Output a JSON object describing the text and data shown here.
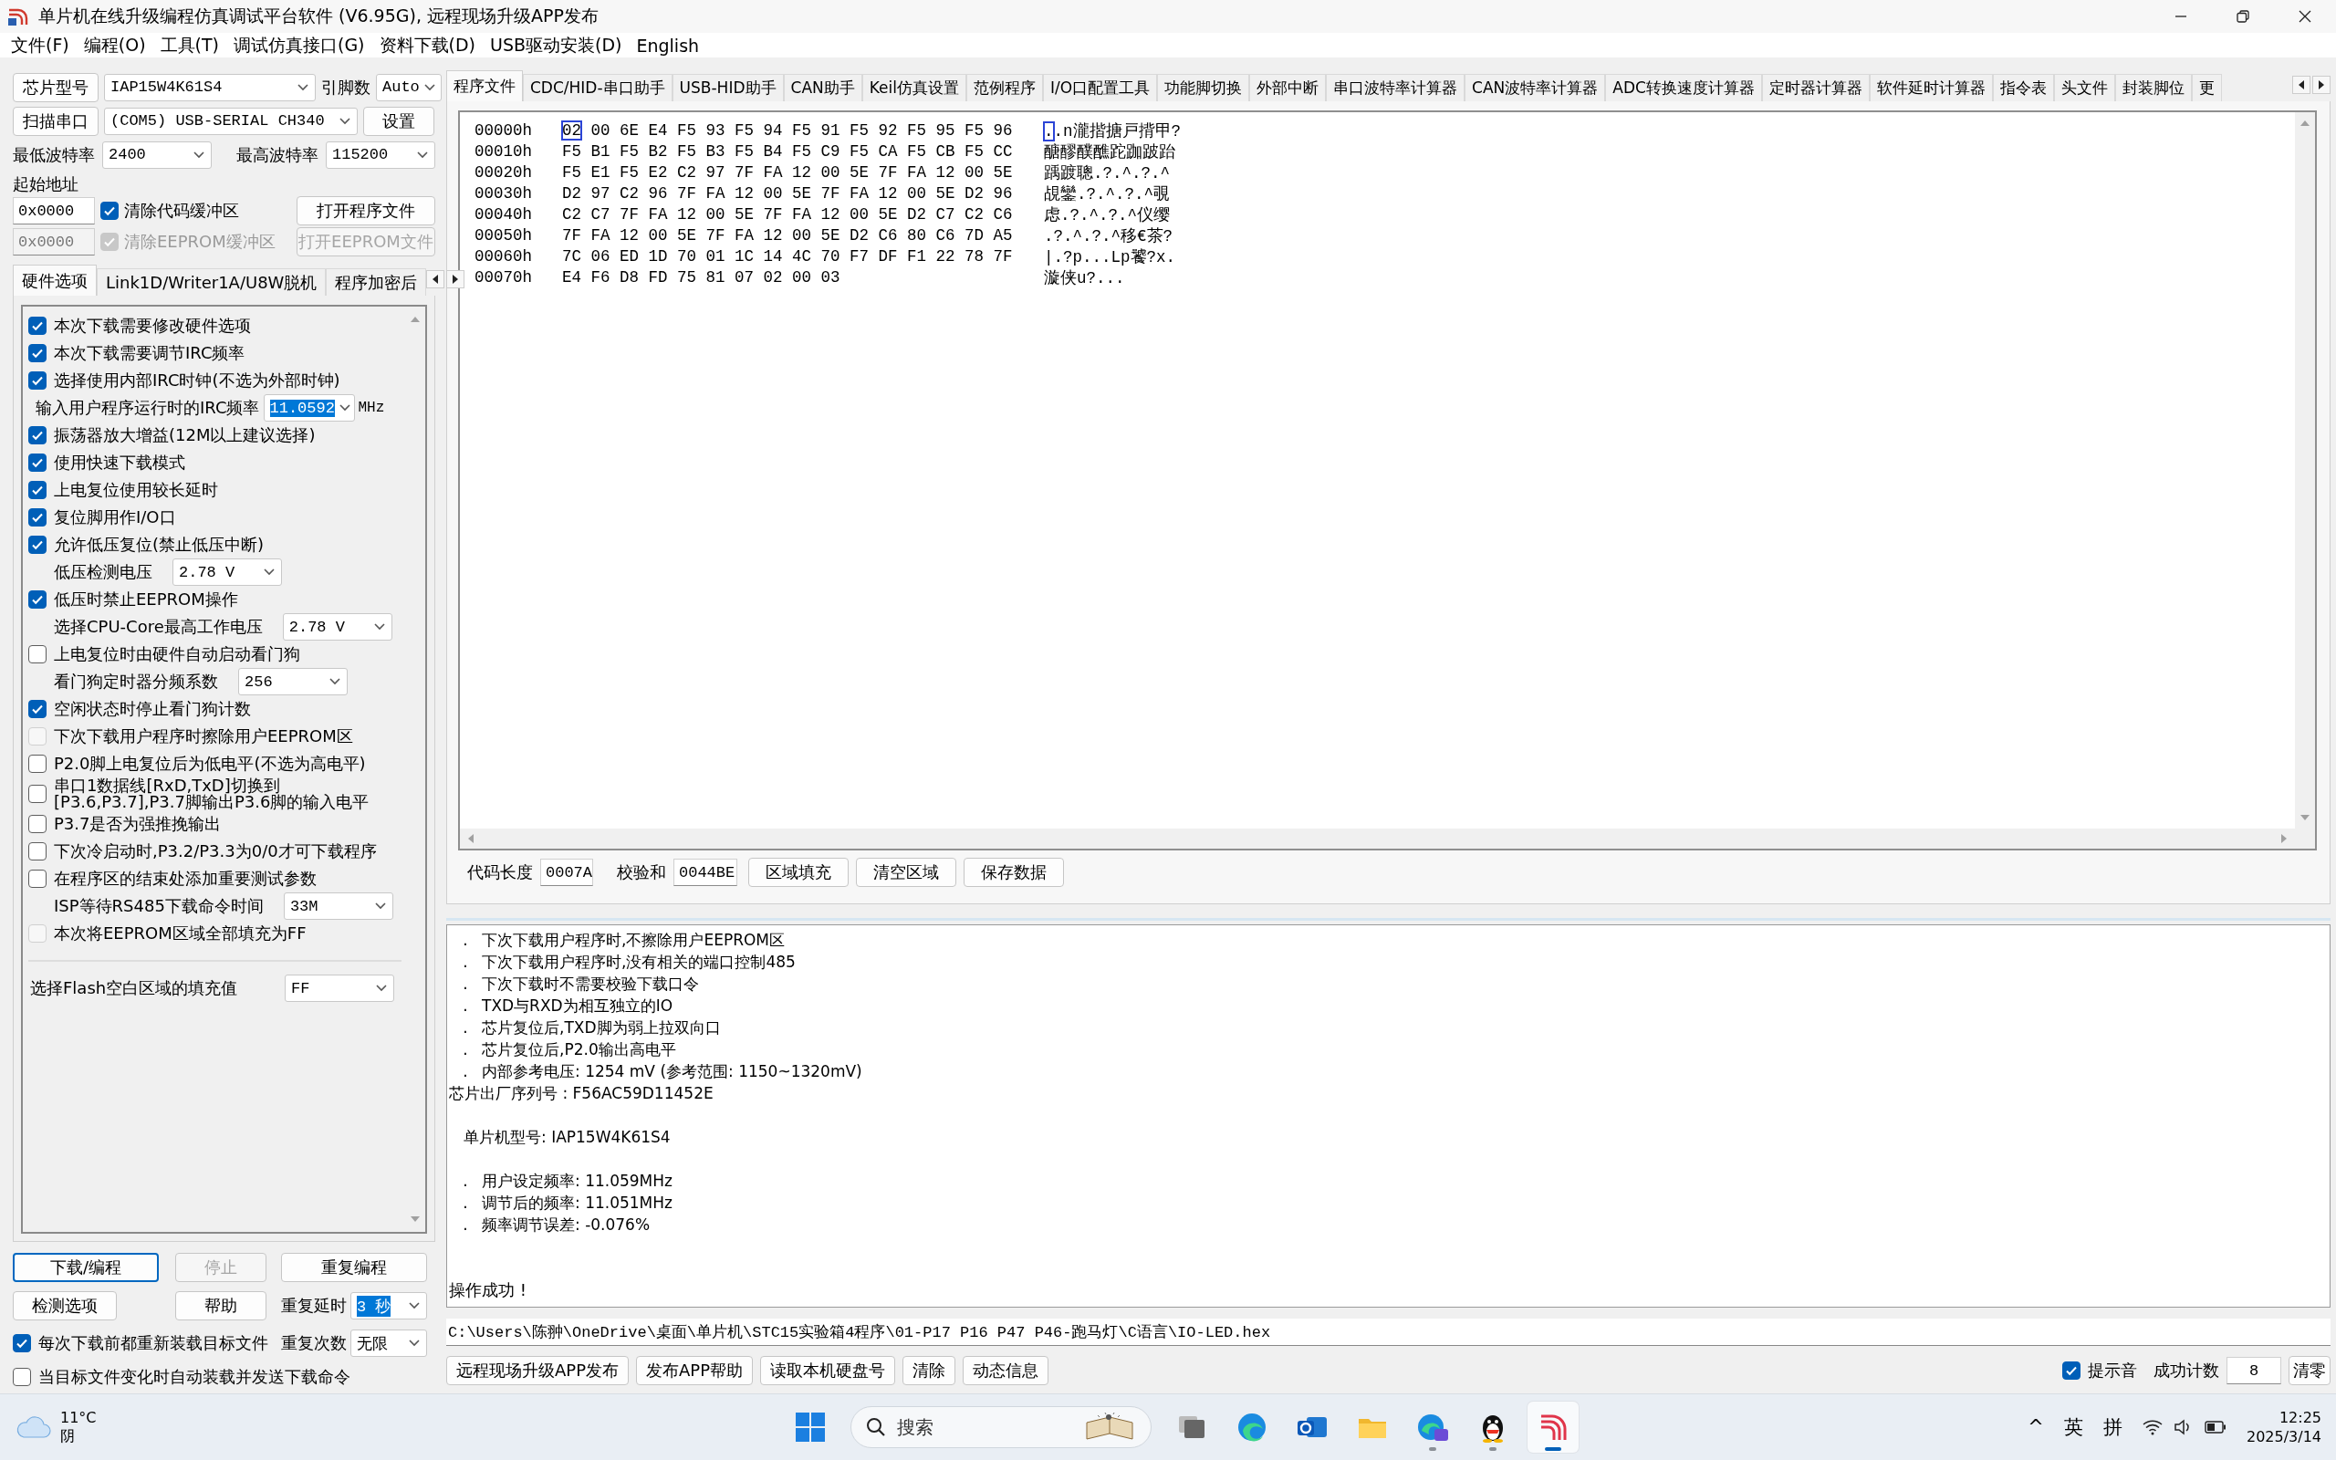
{
  "window": {
    "title": "单片机在线升级编程仿真调试平台软件 (V6.95G), 远程现场升级APP发布"
  },
  "menu": [
    "文件(F)",
    "编程(O)",
    "工具(T)",
    "调试仿真接口(G)",
    "资料下载(D)",
    "USB驱动安装(D)",
    "English"
  ],
  "left_panel": {
    "chip": {
      "button": "芯片型号",
      "value": "IAP15W4K61S4",
      "pins_label": "引脚数",
      "pins_value": "Auto"
    },
    "port": {
      "button": "扫描串口",
      "value": "(COM5) USB-SERIAL CH340",
      "settings_button": "设置"
    },
    "baud": {
      "min_label": "最低波特率",
      "min_value": "2400",
      "max_label": "最高波特率",
      "max_value": "115200"
    },
    "start_address_label": "起始地址",
    "buffers": [
      {
        "address": "0x0000",
        "label": "清除代码缓冲区",
        "checked": true,
        "disabled": false,
        "button": "打开程序文件"
      },
      {
        "address": "0x0000",
        "label": "清除EEPROM缓冲区",
        "checked": true,
        "disabled": true,
        "button": "打开EEPROM文件"
      }
    ],
    "tabs": [
      {
        "label": "硬件选项",
        "selected": true
      },
      {
        "label": "Link1D/Writer1A/U8W脱机",
        "selected": false
      },
      {
        "label": "程序加密后",
        "selected": false
      }
    ],
    "options": [
      {
        "kind": "checkbox",
        "label": "本次下载需要修改硬件选项",
        "checked": true,
        "disabled": false
      },
      {
        "kind": "checkbox",
        "label": "本次下载需要调节IRC频率",
        "checked": true,
        "disabled": false
      },
      {
        "kind": "checkbox",
        "label": "选择使用内部IRC时钟(不选为外部时钟)",
        "checked": true,
        "disabled": false
      },
      {
        "kind": "input",
        "label": "输入用户程序运行时的IRC频率",
        "value": "11.0592",
        "unit": "MHz"
      },
      {
        "kind": "checkbox",
        "label": "振荡器放大增益(12M以上建议选择)",
        "checked": true,
        "disabled": false
      },
      {
        "kind": "checkbox",
        "label": "使用快速下载模式",
        "checked": true,
        "disabled": false
      },
      {
        "kind": "checkbox",
        "label": "上电复位使用较长延时",
        "checked": true,
        "disabled": false
      },
      {
        "kind": "checkbox",
        "label": "复位脚用作I/O口",
        "checked": true,
        "disabled": false
      },
      {
        "kind": "checkbox",
        "label": "允许低压复位(禁止低压中断)",
        "checked": true,
        "disabled": false
      },
      {
        "kind": "select",
        "label": "低压检测电压",
        "value": "2.78 V"
      },
      {
        "kind": "checkbox",
        "label": "低压时禁止EEPROM操作",
        "checked": true,
        "disabled": false
      },
      {
        "kind": "select",
        "label": "选择CPU-Core最高工作电压",
        "value": "2.78 V"
      },
      {
        "kind": "checkbox",
        "label": "上电复位时由硬件自动启动看门狗",
        "checked": false,
        "disabled": false
      },
      {
        "kind": "select",
        "label": "看门狗定时器分频系数",
        "value": "256"
      },
      {
        "kind": "checkbox",
        "label": "空闲状态时停止看门狗计数",
        "checked": true,
        "disabled": false
      },
      {
        "kind": "checkbox",
        "label": "下次下载用户程序时擦除用户EEPROM区",
        "checked": false,
        "disabled": true
      },
      {
        "kind": "checkbox",
        "label": "P2.0脚上电复位后为低电平(不选为高电平)",
        "checked": false,
        "disabled": false
      },
      {
        "kind": "checkbox",
        "label": "串口1数据线[RxD,TxD]切换到\n[P3.6,P3.7],P3.7脚输出P3.6脚的输入电平",
        "checked": false,
        "disabled": false
      },
      {
        "kind": "checkbox",
        "label": "P3.7是否为强推挽输出",
        "checked": false,
        "disabled": false
      },
      {
        "kind": "checkbox",
        "label": "下次冷启动时,P3.2/P3.3为0/0才可下载程序",
        "checked": false,
        "disabled": false
      },
      {
        "kind": "checkbox",
        "label": "在程序区的结束处添加重要测试参数",
        "checked": false,
        "disabled": false
      },
      {
        "kind": "select",
        "label": "ISP等待RS485下载命令时间",
        "value": "33M"
      },
      {
        "kind": "checkbox",
        "label": "本次将EEPROM区域全部填充为FF",
        "checked": false,
        "disabled": true
      }
    ],
    "fill": {
      "label": "选择Flash空白区域的填充值",
      "value": "FF"
    },
    "buttons": [
      {
        "label": "下载/编程",
        "disabled": false,
        "focused": true
      },
      {
        "label": "停止",
        "disabled": true,
        "focused": false
      },
      {
        "label": "重复编程",
        "disabled": false,
        "focused": false
      },
      {
        "label": "检测选项",
        "disabled": false,
        "focused": false
      },
      {
        "label": "帮助",
        "disabled": false,
        "focused": false
      }
    ],
    "repeat_delay": {
      "label": "重复延时",
      "value": "3 秒"
    },
    "repeat_count": {
      "label": "重复次数",
      "value": "无限"
    },
    "auto_checks": [
      {
        "label": "每次下载前都重新装载目标文件",
        "checked": true
      },
      {
        "label": "当目标文件变化时自动装载并发送下载命令",
        "checked": false
      }
    ]
  },
  "right_panel": {
    "tabs": [
      {
        "label": "程序文件",
        "selected": true
      },
      {
        "label": "CDC/HID-串口助手",
        "selected": false
      },
      {
        "label": "USB-HID助手",
        "selected": false
      },
      {
        "label": "CAN助手",
        "selected": false
      },
      {
        "label": "Keil仿真设置",
        "selected": false
      },
      {
        "label": "范例程序",
        "selected": false
      },
      {
        "label": "I/O口配置工具",
        "selected": false
      },
      {
        "label": "功能脚切换",
        "selected": false
      },
      {
        "label": "外部中断",
        "selected": false
      },
      {
        "label": "串口波特率计算器",
        "selected": false
      },
      {
        "label": "CAN波特率计算器",
        "selected": false
      },
      {
        "label": "ADC转换速度计算器",
        "selected": false
      },
      {
        "label": "定时器计算器",
        "selected": false
      },
      {
        "label": "软件延时计算器",
        "selected": false
      },
      {
        "label": "指令表",
        "selected": false
      },
      {
        "label": "头文件",
        "selected": false
      },
      {
        "label": "封装脚位",
        "selected": false
      },
      {
        "label": "更",
        "selected": false
      }
    ],
    "hex_rows": [
      {
        "address": "00000h",
        "bytes": "02 00 6E E4 F5 93 F5 94 F5 91 F5 92 F5 95 F5 96",
        "ascii": "..n瀧揩搪戸揹甲?",
        "cursor": true
      },
      {
        "address": "00010h",
        "bytes": "F5 B1 F5 B2 F5 B3 F5 B4 F5 C9 F5 CA F5 CB F5 CC",
        "ascii": "醣醪醭醮跎跏跛跆",
        "cursor": false
      },
      {
        "address": "00020h",
        "bytes": "F5 E1 F5 E2 C2 97 7F FA 12 00 5E 7F FA 12 00 5E",
        "ascii": "踽踱聰.?.^.?.^",
        "cursor": false
      },
      {
        "address": "00030h",
        "bytes": "D2 97 C2 96 7F FA 12 00 5E 7F FA 12 00 5E D2 96",
        "ascii": "覘鑾.?.^.?.^覗",
        "cursor": false
      },
      {
        "address": "00040h",
        "bytes": "C2 C7 7F FA 12 00 5E 7F FA 12 00 5E D2 C7 C2 C6",
        "ascii": "虑.?.^.?.^仪缨",
        "cursor": false
      },
      {
        "address": "00050h",
        "bytes": "7F FA 12 00 5E 7F FA 12 00 5E D2 C6 80 C6 7D A5",
        "ascii": ".?.^.?.^移€茶?",
        "cursor": false
      },
      {
        "address": "00060h",
        "bytes": "7C 06 ED 1D 70 01 1C 14 4C 70 F7 DF F1 22 78 7F",
        "ascii": "|.?p...Lp饕?x.",
        "cursor": false
      },
      {
        "address": "00070h",
        "bytes": "E4 F6 D8 FD 75 81 07 02 00 03",
        "ascii": "漩侠u?...",
        "cursor": false
      }
    ],
    "code_length": {
      "label": "代码长度",
      "value": "0007A"
    },
    "checksum": {
      "label": "校验和",
      "value": "0044BE"
    },
    "hex_buttons": [
      "区域填充",
      "清空区域",
      "保存数据"
    ],
    "log": [
      {
        "kind": "bullet",
        "bullet": ".",
        "text": "下次下载用户程序时,不擦除用户EEPROM区"
      },
      {
        "kind": "bullet",
        "bullet": ".",
        "text": "下次下载用户程序时,没有相关的端口控制485"
      },
      {
        "kind": "bullet",
        "bullet": ".",
        "text": "下次下载时不需要校验下载口令"
      },
      {
        "kind": "bullet",
        "bullet": ".",
        "text": "TXD与RXD为相互独立的IO"
      },
      {
        "kind": "bullet",
        "bullet": ".",
        "text": "芯片复位后,TXD脚为弱上拉双向口"
      },
      {
        "kind": "bullet",
        "bullet": ".",
        "text": "芯片复位后,P2.0输出高电平"
      },
      {
        "kind": "bullet",
        "bullet": ".",
        "text": "内部参考电压: 1254 mV (参考范围: 1150~1320mV)"
      },
      {
        "kind": "plain",
        "text": "芯片出厂序列号 : F56AC59D11452E"
      },
      {
        "kind": "heading",
        "text": "单片机型号: IAP15W4K61S4"
      },
      {
        "kind": "section",
        "bullet": ".",
        "text": "用户设定频率: 11.059MHz"
      },
      {
        "kind": "bullet",
        "bullet": ".",
        "text": "调节后的频率: 11.051MHz"
      },
      {
        "kind": "bullet",
        "bullet": ".",
        "text": "频率调节误差: -0.076%"
      },
      {
        "kind": "result",
        "text": "操作成功 !"
      }
    ],
    "path": "C:\\Users\\陈翀\\OneDrive\\桌面\\单片机\\STC15实验箱4程序\\01-P17 P16 P47 P46-跑马灯\\C语言\\IO-LED.hex",
    "bottom_buttons": [
      "远程现场升级APP发布",
      "发布APP帮助",
      "读取本机硬盘号",
      "清除",
      "动态信息"
    ],
    "sound": {
      "label": "提示音",
      "checked": true
    },
    "success_count": {
      "label": "成功计数",
      "value": "8",
      "reset_button": "清零"
    }
  },
  "taskbar": {
    "temperature": "11°C",
    "weather": "阴",
    "search": {
      "placeholder": "搜索"
    },
    "apps": [
      {
        "running": false,
        "active": false
      },
      {
        "running": false,
        "active": false
      },
      {
        "running": false,
        "active": false
      },
      {
        "running": false,
        "active": false
      },
      {
        "running": true,
        "active": false
      },
      {
        "running": true,
        "active": false
      },
      {
        "running": true,
        "active": true
      }
    ],
    "tray_chevron": "^",
    "input_language": "英",
    "input_mode": "拼",
    "time": "12:25",
    "date": "2025/3/14"
  }
}
